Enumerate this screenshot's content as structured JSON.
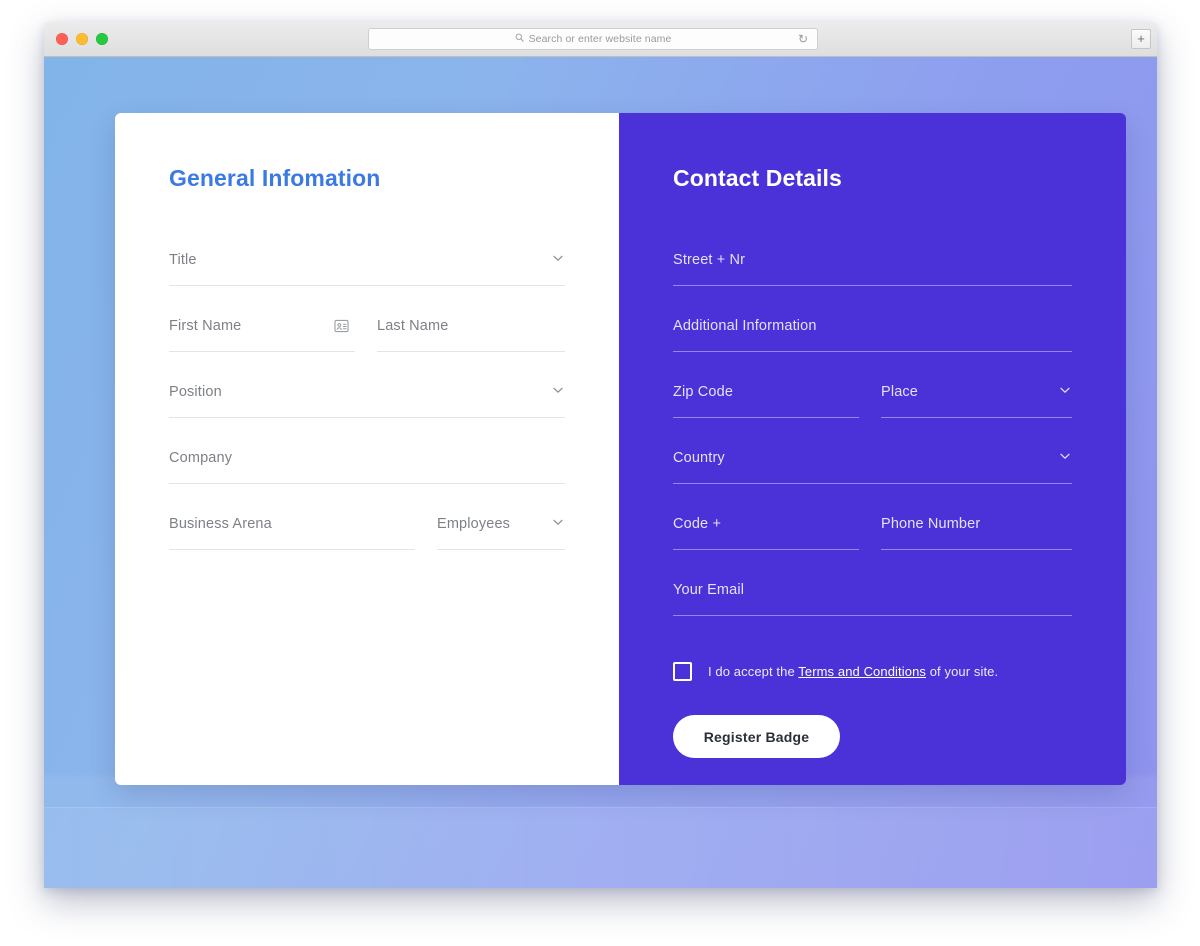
{
  "browser": {
    "traffic_lights": [
      "close",
      "minimize",
      "maximize"
    ],
    "address_placeholder": "Search or enter website name",
    "search_icon": "search-icon",
    "reload_icon": "reload-icon",
    "new_tab_label": "+"
  },
  "colors": {
    "panel_purple": "#4a32d8",
    "heading_blue": "#3b7ae4",
    "backdrop_left": "#82b4e9",
    "backdrop_right": "#8f92ee",
    "button_bg": "#ffffff",
    "button_text": "#2b2f3a"
  },
  "general": {
    "title": "General Infomation",
    "rows": [
      {
        "fields": [
          {
            "placeholder": "Title",
            "name": "title-select",
            "control": "select",
            "width": "w-wide"
          }
        ]
      },
      {
        "fields": [
          {
            "placeholder": "First Name",
            "name": "first-name-input",
            "control": "text",
            "icon": "contact-card-icon",
            "width": "w-narrow"
          },
          {
            "placeholder": "Last Name",
            "name": "last-name-input",
            "control": "text",
            "width": "w-rest"
          }
        ]
      },
      {
        "fields": [
          {
            "placeholder": "Position",
            "name": "position-select",
            "control": "select",
            "width": "w-wide"
          }
        ]
      },
      {
        "fields": [
          {
            "placeholder": "Company",
            "name": "company-input",
            "control": "text",
            "width": "w-wide"
          }
        ]
      },
      {
        "fields": [
          {
            "placeholder": "Business Arena",
            "name": "business-arena-input",
            "control": "text",
            "width": "w-mid"
          },
          {
            "placeholder": "Employees",
            "name": "employees-select",
            "control": "select",
            "width": "w-rest"
          }
        ]
      }
    ]
  },
  "contact": {
    "title": "Contact Details",
    "rows": [
      {
        "fields": [
          {
            "placeholder": "Street + Nr",
            "name": "street-input",
            "control": "text",
            "width": "w-wide"
          }
        ]
      },
      {
        "fields": [
          {
            "placeholder": "Additional Information",
            "name": "additional-information-input",
            "control": "text",
            "width": "w-wide"
          }
        ]
      },
      {
        "fields": [
          {
            "placeholder": "Zip Code",
            "name": "zip-code-input",
            "control": "text",
            "width": "w-narrow"
          },
          {
            "placeholder": "Place",
            "name": "place-select",
            "control": "select",
            "width": "w-rest"
          }
        ]
      },
      {
        "fields": [
          {
            "placeholder": "Country",
            "name": "country-select",
            "control": "select",
            "width": "w-wide"
          }
        ]
      },
      {
        "fields": [
          {
            "placeholder": "Code +",
            "name": "country-code-input",
            "control": "text",
            "width": "w-narrow"
          },
          {
            "placeholder": "Phone Number",
            "name": "phone-number-input",
            "control": "text",
            "width": "w-rest"
          }
        ]
      },
      {
        "fields": [
          {
            "placeholder": "Your Email",
            "name": "email-input",
            "control": "text",
            "width": "w-wide"
          }
        ]
      }
    ],
    "terms": {
      "checked": false,
      "prefix": "I do accept the ",
      "link": "Terms and Conditions",
      "suffix": " of your site."
    },
    "submit_label": "Register Badge"
  }
}
